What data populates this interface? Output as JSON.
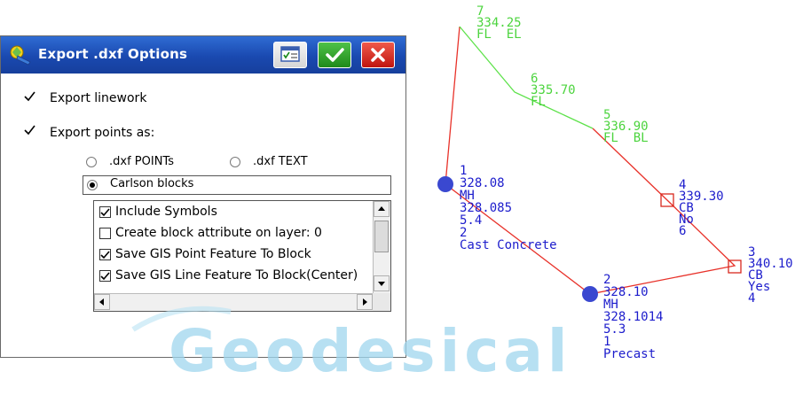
{
  "dialog": {
    "title": "Export .dxf Options",
    "buttons": {
      "form_icon": "form-icon",
      "ok_icon": "check-icon",
      "cancel_icon": "close-icon"
    },
    "export_linework": {
      "label": "Export linework",
      "checked": true
    },
    "export_points_as": {
      "label": "Export points as:",
      "checked": true
    },
    "options": {
      "dxf_points": {
        "label": ".dxf POINTs",
        "selected": false
      },
      "dxf_text": {
        "label": ".dxf TEXT",
        "selected": false
      },
      "carlson_blocks": {
        "label": "Carlson blocks",
        "selected": true
      }
    },
    "list_items": [
      {
        "label": "Include Symbols",
        "checked": true
      },
      {
        "label": "Create block attribute on layer: 0",
        "checked": false
      },
      {
        "label": "Save GIS Point Feature To Block",
        "checked": true
      },
      {
        "label": "Save GIS Line Feature To Block(Center)",
        "checked": true
      }
    ]
  },
  "drawing": {
    "colors": {
      "linework_red": "#e8322a",
      "linework_green": "#5ee24b",
      "text_blue": "#1c1ccc",
      "text_green": "#4cd43e",
      "node_blue": "#3a48d0",
      "box_red": "#d8281e"
    },
    "points": {
      "p7": {
        "lines": [
          "7",
          "334.25",
          "FL  EL"
        ]
      },
      "p6": {
        "lines": [
          "6",
          "335.70",
          "FL"
        ]
      },
      "p5": {
        "lines": [
          "5",
          "336.90",
          "FL  BL"
        ]
      },
      "p4": {
        "lines": [
          "4",
          "339.30",
          "CB",
          "No",
          "6"
        ]
      },
      "p3": {
        "lines": [
          "3",
          "340.10",
          "CB",
          "Yes",
          "4"
        ]
      },
      "p2": {
        "lines": [
          "2",
          "328.10",
          "MH",
          "328.1014",
          "5.3",
          "1",
          "Precast"
        ]
      },
      "p1": {
        "lines": [
          "1",
          "328.08",
          "MH",
          "328.085",
          "5.4",
          "2",
          "Cast Concrete"
        ]
      }
    }
  },
  "watermark": {
    "text": "Geodesical"
  }
}
